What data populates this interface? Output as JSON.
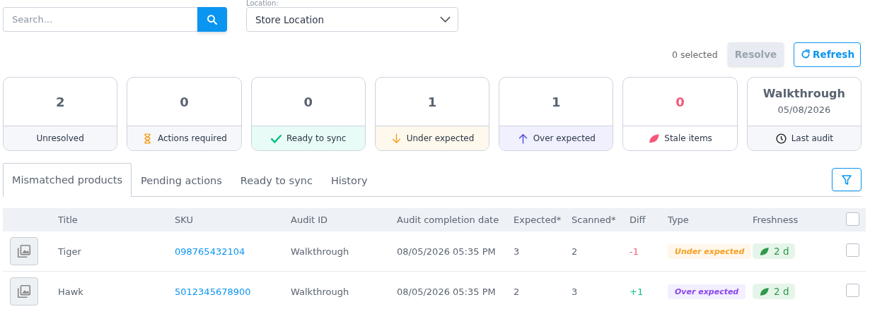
{
  "search": {
    "placeholder": "Search..."
  },
  "location": {
    "label": "Location:",
    "value": "Store Location"
  },
  "selection": {
    "count_text": "0 selected",
    "resolve": {
      "label": "Resolve",
      "disabled": true
    },
    "refresh": {
      "label": "Refresh"
    }
  },
  "cards": [
    {
      "kind": "unresolved",
      "value": "2",
      "label": "Unresolved"
    },
    {
      "kind": "actions",
      "value": "0",
      "label": "Actions required"
    },
    {
      "kind": "ready",
      "value": "0",
      "label": "Ready to sync"
    },
    {
      "kind": "under",
      "value": "1",
      "label": "Under expected"
    },
    {
      "kind": "over",
      "value": "1",
      "label": "Over expected"
    },
    {
      "kind": "stale",
      "value": "0",
      "label": "Stale items"
    },
    {
      "kind": "audit",
      "value": "Walkthrough",
      "sub": "05/08/2026",
      "label": "Last audit"
    }
  ],
  "tabs": [
    {
      "label": "Mismatched products",
      "selected": true
    },
    {
      "label": "Pending actions",
      "selected": false
    },
    {
      "label": "Ready to sync",
      "selected": false
    },
    {
      "label": "History",
      "selected": false
    }
  ],
  "table": {
    "columns": [
      "Title",
      "SKU",
      "Audit ID",
      "Audit completion date",
      "Expected*",
      "Scanned*",
      "Diff",
      "Type",
      "Freshness"
    ],
    "select_all_checked": false,
    "rows": [
      {
        "title": "Tiger",
        "sku": "098765432104",
        "audit_id": "Walkthrough",
        "date": "08/05/2026 05:35 PM",
        "expected": "3",
        "scanned": "2",
        "diff": "-1",
        "type": {
          "kind": "under",
          "label": "Under expected"
        },
        "freshness": "2 d",
        "checked": false
      },
      {
        "title": "Hawk",
        "sku": "5012345678900",
        "audit_id": "Walkthrough",
        "date": "08/05/2026 05:35 PM",
        "expected": "2",
        "scanned": "3",
        "diff": "+1",
        "type": {
          "kind": "over",
          "label": "Over expected"
        },
        "freshness": "2 d",
        "checked": false
      }
    ]
  }
}
